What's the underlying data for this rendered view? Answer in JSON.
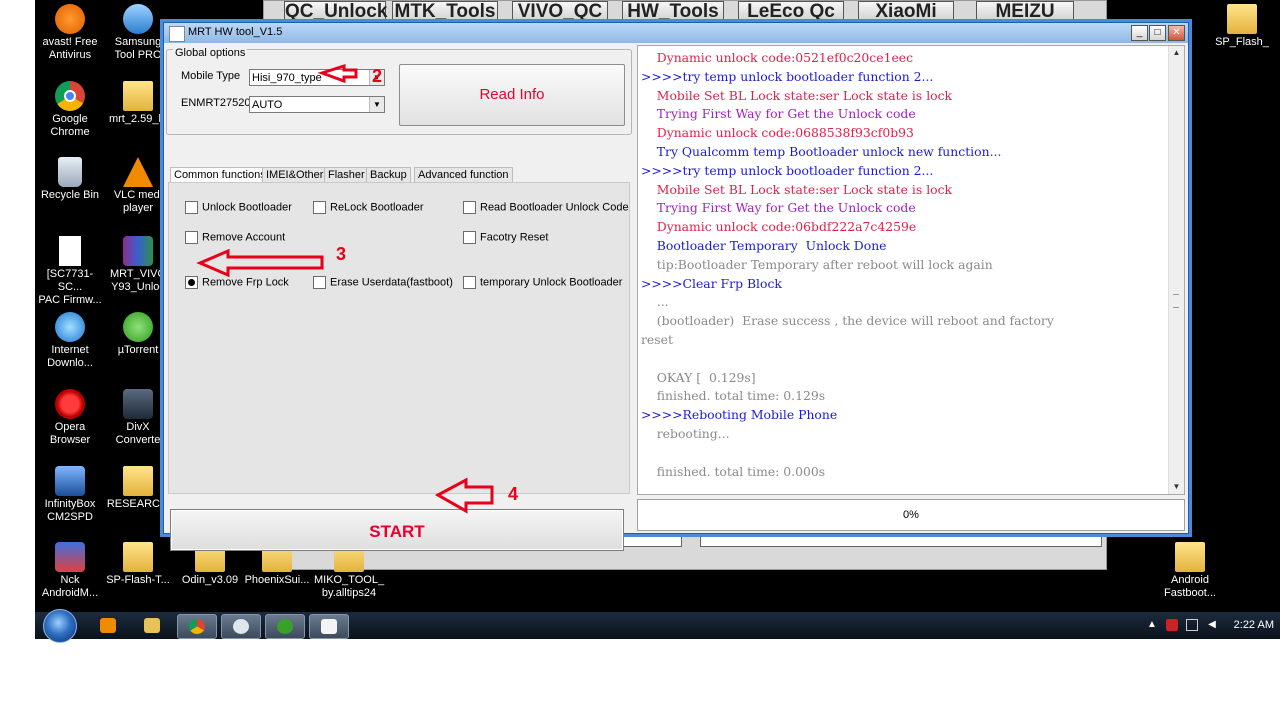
{
  "desktop": {
    "icons_left": [
      {
        "label_line1": "avast! Free",
        "label_line2": "Antivirus",
        "icon": "avast-icon"
      },
      {
        "label_line1": "Google",
        "label_line2": "Chrome",
        "icon": "chrome-icon"
      },
      {
        "label_line1": "Recycle Bin",
        "label_line2": "",
        "icon": "recycle-bin-icon"
      },
      {
        "label_line1": "[SC7731-SC...",
        "label_line2": "PAC Firmw...",
        "icon": "file-icon"
      },
      {
        "label_line1": "Internet",
        "label_line2": "Downlo...",
        "icon": "internet-download-icon"
      },
      {
        "label_line1": "Opera",
        "label_line2": "Browser",
        "icon": "opera-icon"
      },
      {
        "label_line1": "InfinityBox",
        "label_line2": "CM2SPD",
        "icon": "infinitybox-icon"
      },
      {
        "label_line1": "Nck",
        "label_line2": "AndroidM...",
        "icon": "nck-icon"
      }
    ],
    "icons_second": [
      {
        "label_line1": "Samsung",
        "label_line2": "Tool PRO",
        "icon": "samsung-tool-icon"
      },
      {
        "label_line1": "mrt_2.59_la",
        "label_line2": "",
        "icon": "folder-icon"
      },
      {
        "label_line1": "VLC medi",
        "label_line2": "player",
        "icon": "vlc-icon"
      },
      {
        "label_line1": "MRT_VIVO",
        "label_line2": "Y93_Unloc",
        "icon": "winrar-icon"
      },
      {
        "label_line1": "µTorrent",
        "label_line2": "",
        "icon": "utorrent-icon"
      },
      {
        "label_line1": "DivX",
        "label_line2": "Converte",
        "icon": "divx-icon"
      },
      {
        "label_line1": "RESEARC...",
        "label_line2": "",
        "icon": "folder-icon"
      },
      {
        "label_line1": "SP-Flash-T...",
        "label_line2": "",
        "icon": "folder-icon"
      }
    ],
    "icons_bottom": [
      {
        "label_line1": "Odin_v3.09",
        "label_line2": "",
        "icon": "folder-icon"
      },
      {
        "label_line1": "PhoenixSui...",
        "label_line2": "",
        "icon": "folder-icon"
      },
      {
        "label_line1": "MIKO_TOOL_",
        "label_line2": "by.alltips24",
        "icon": "folder-icon"
      }
    ],
    "icons_right": [
      {
        "label_line1": "SP_Flash_",
        "label_line2": "",
        "icon": "folder-icon"
      },
      {
        "label_line1": "Android",
        "label_line2": "Fastboot...",
        "icon": "folder-icon"
      }
    ]
  },
  "background_app": {
    "tabs": [
      "QC_Unlock",
      "MTK_Tools",
      "VIVO_QC",
      "HW_Tools",
      "LeEco Qc",
      "XiaoMi",
      "MEIZU"
    ],
    "progress_text": "0%"
  },
  "window": {
    "title": "MRT HW tool_V1.5",
    "minimize": "_",
    "maximize": "□",
    "close": "✕"
  },
  "global_options": {
    "legend": "Global options",
    "mobile_type_label": "Mobile Type",
    "mobile_type_value": "Hisi_970_type",
    "enmrt_label": "ENMRT27520",
    "enmrt_value": "AUTO",
    "read_info_label": "Read Info"
  },
  "tabs": [
    {
      "label": "Common functions",
      "active": true
    },
    {
      "label": "IMEI&Others",
      "active": false
    },
    {
      "label": "Flasher",
      "active": false
    },
    {
      "label": "Backup",
      "active": false
    },
    {
      "label": "Advanced function",
      "active": false
    }
  ],
  "options": {
    "unlock_bootloader": {
      "label": "Unlock Bootloader",
      "checked": false
    },
    "relock_bootloader": {
      "label": "ReLock Bootloader",
      "checked": false
    },
    "read_bootloader_unlock_code": {
      "label": "Read Bootloader Unlock Code",
      "checked": false
    },
    "remove_account": {
      "label": "Remove Account",
      "checked": false
    },
    "factory_reset": {
      "label": "Facotry Reset",
      "checked": false
    },
    "remove_frp_lock": {
      "label": "Remove Frp Lock",
      "checked": true
    },
    "erase_userdata": {
      "label": "Erase Userdata(fastboot)",
      "checked": false
    },
    "temporary_unlock_bootloader": {
      "label": "temporary Unlock Bootloader",
      "checked": false
    }
  },
  "start_label": "START",
  "progress_text": "0%",
  "annotations": {
    "n2": "2",
    "n3": "3",
    "n4": "4"
  },
  "log": [
    {
      "text": "    Dynamic unlock code:0521ef0c20ce1eec",
      "color": "red"
    },
    {
      "text": ">>>>try temp unlock bootloader function 2...",
      "color": "blue"
    },
    {
      "text": "    Mobile Set BL Lock state:ser Lock state is lock",
      "color": "red"
    },
    {
      "text": "    Trying First Way for Get the Unlock code",
      "color": "purple"
    },
    {
      "text": "    Dynamic unlock code:0688538f93cf0b93",
      "color": "red"
    },
    {
      "text": "    Try Qualcomm temp Bootloader unlock new function...",
      "color": "blue"
    },
    {
      "text": ">>>>try temp unlock bootloader function 2...",
      "color": "blue"
    },
    {
      "text": "    Mobile Set BL Lock state:ser Lock state is lock",
      "color": "red"
    },
    {
      "text": "    Trying First Way for Get the Unlock code",
      "color": "purple"
    },
    {
      "text": "    Dynamic unlock code:06bdf222a7c4259e",
      "color": "red"
    },
    {
      "text": "    Bootloader Temporary  Unlock Done",
      "color": "blue"
    },
    {
      "text": "    tip:Bootloader Temporary after reboot will lock again",
      "color": "gray"
    },
    {
      "text": ">>>>Clear Frp Block",
      "color": "blue"
    },
    {
      "text": "    ...",
      "color": "gray"
    },
    {
      "text": "    (bootloader)  Erase success , the device will reboot and factory",
      "color": "gray"
    },
    {
      "text": "reset",
      "color": "gray"
    },
    {
      "text": "",
      "color": "gray"
    },
    {
      "text": "    OKAY [  0.129s]",
      "color": "gray"
    },
    {
      "text": "    finished. total time: 0.129s",
      "color": "gray"
    },
    {
      "text": ">>>>Rebooting Mobile Phone",
      "color": "blue"
    },
    {
      "text": "    rebooting...",
      "color": "gray"
    },
    {
      "text": "",
      "color": "gray"
    },
    {
      "text": "    finished. total time: 0.000s",
      "color": "gray"
    }
  ],
  "taskbar": {
    "clock": "2:22 AM",
    "apps": [
      "media-player-icon",
      "explorer-icon",
      "chrome-icon",
      "globe-icon",
      "utorrent-icon",
      "mrt-tool-icon"
    ]
  }
}
